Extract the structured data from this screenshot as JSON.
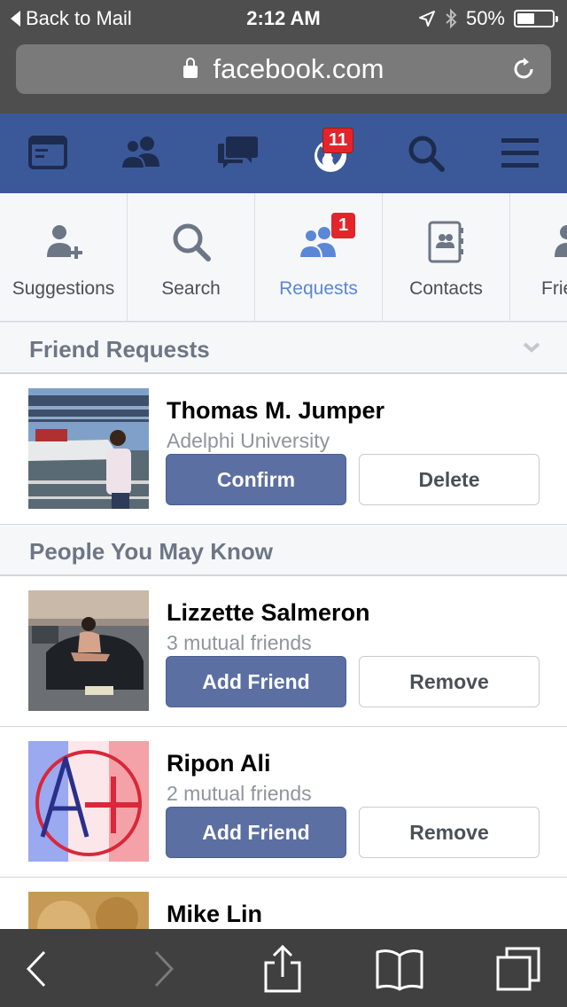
{
  "status_bar": {
    "back_label": "Back to Mail",
    "time": "2:12 AM",
    "battery_text": "50%",
    "battery_level": 0.5
  },
  "url_bar": {
    "domain": "facebook.com"
  },
  "fb_nav": {
    "notifications_badge": "11",
    "icons": [
      "news-feed-icon",
      "friends-icon",
      "messages-icon",
      "globe-icon",
      "search-icon",
      "menu-icon"
    ]
  },
  "subtabs": {
    "items": [
      {
        "label": "Suggestions",
        "icon": "add-person-icon"
      },
      {
        "label": "Search",
        "icon": "search-icon"
      },
      {
        "label": "Requests",
        "icon": "friends-icon",
        "badge": "1"
      },
      {
        "label": "Contacts",
        "icon": "contacts-book-icon"
      },
      {
        "label": "Friends",
        "icon": "person-icon"
      }
    ]
  },
  "friend_requests": {
    "title": "Friend Requests",
    "items": [
      {
        "name": "Thomas M. Jumper",
        "subtitle": "Adelphi University",
        "confirm_label": "Confirm",
        "delete_label": "Delete"
      }
    ]
  },
  "people_you_may_know": {
    "title": "People You May Know",
    "items": [
      {
        "name": "Lizzette Salmeron",
        "subtitle": "3 mutual friends",
        "add_label": "Add Friend",
        "remove_label": "Remove"
      },
      {
        "name": "Ripon Ali",
        "subtitle": "2 mutual friends",
        "add_label": "Add Friend",
        "remove_label": "Remove"
      },
      {
        "name": "Mike Lin"
      }
    ]
  },
  "colors": {
    "fb_blue": "#3b5998",
    "button_blue": "#5b6fa3",
    "badge_red": "#e3242b",
    "active_tab": "#5b87d6"
  }
}
